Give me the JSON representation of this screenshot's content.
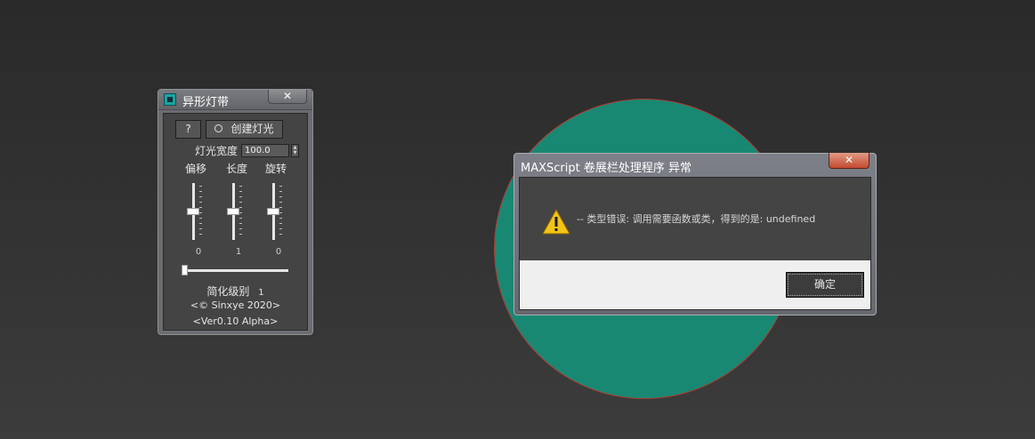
{
  "panel": {
    "title": "异形灯带",
    "close_glyph": "✕",
    "help_label": "?",
    "create_label": "创建灯光",
    "width_label": "灯光宽度",
    "width_value": "100.0",
    "slider_headers": [
      "偏移",
      "长度",
      "旋转"
    ],
    "slider_values": [
      "0",
      "1",
      "0"
    ],
    "simplify_label": "简化级别",
    "simplify_value": "1",
    "copyright": "<© Sinxye 2020>",
    "version": "<Ver0.10 Alpha>"
  },
  "dialog": {
    "title": "MAXScript 卷展栏处理程序 异常",
    "close_glyph": "✕",
    "message": "-- 类型错误: 调用需要函数或类，得到的是: undefined",
    "ok_label": "确定"
  },
  "colors": {
    "viewport_background": "#2e2e2e",
    "teal_object": "#198873",
    "object_outline": "#b23a2e",
    "warning_yellow": "#f3c418"
  }
}
